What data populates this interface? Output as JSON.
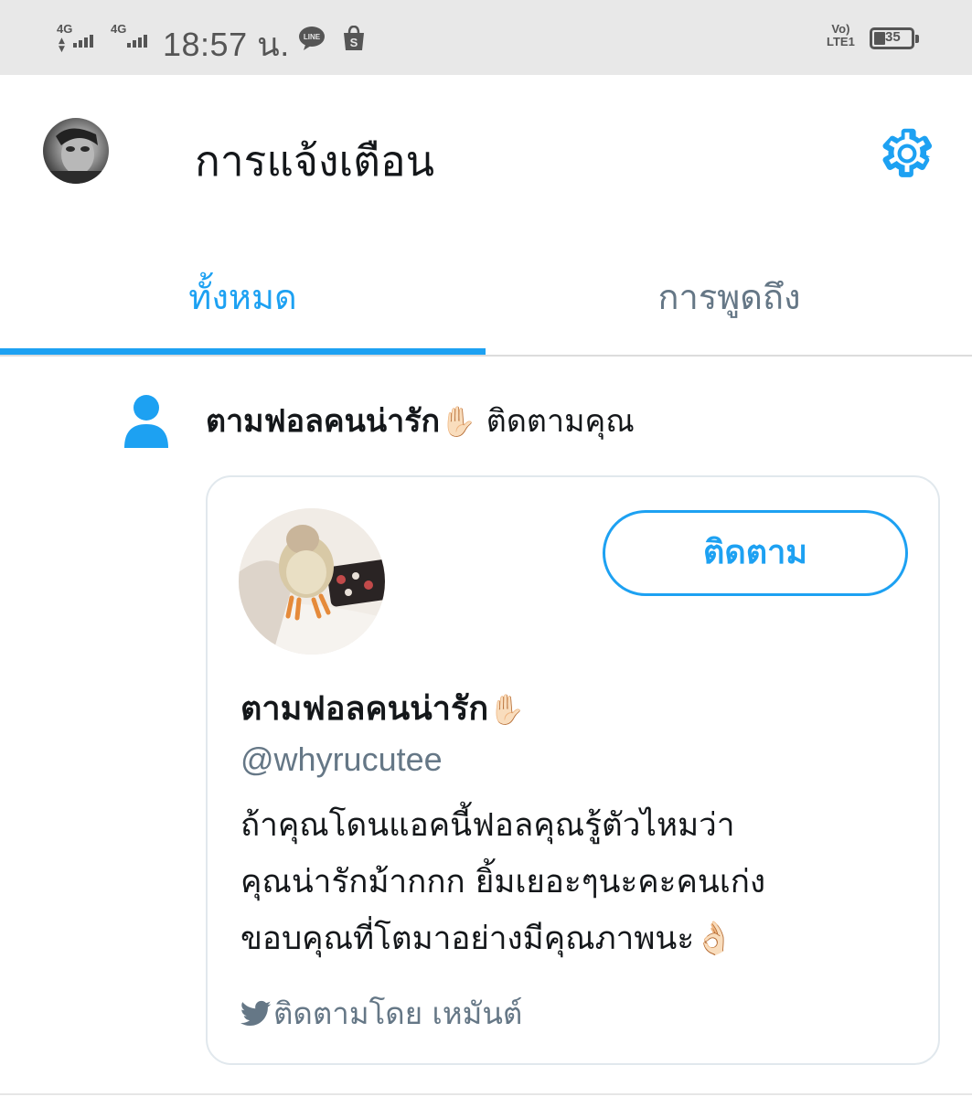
{
  "status_bar": {
    "network_1": "4G",
    "network_2": "4G",
    "time": "18:57 น.",
    "volte_top": "Vo)",
    "volte_bottom": "LTE1",
    "battery_level": "35",
    "icons": [
      "signal-icon",
      "signal-icon",
      "line-app-icon",
      "shopee-app-icon",
      "volte-icon",
      "battery-icon"
    ]
  },
  "header": {
    "title": "การแจ้งเตือน",
    "avatar_icon": "profile-avatar",
    "settings_icon": "gear-icon"
  },
  "tabs": [
    {
      "label": "ทั้งหมด",
      "active": true
    },
    {
      "label": "การพูดถึง",
      "active": false
    }
  ],
  "notification": {
    "icon": "person-icon",
    "actor_name": "ตามฟอลคนน่ารัก",
    "actor_emoji": "✋🏻",
    "action_text": "ติดตามคุณ",
    "card": {
      "follow_button": "ติดตาม",
      "name": "ตามฟอลคนน่ารัก",
      "name_emoji": "✋🏻",
      "handle": "@whyrucutee",
      "bio_lines": [
        "ถ้าคุณโดนแอคนี้ฟอลคุณรู้ตัวไหมว่า",
        "คุณน่ารักม้ากกก ยิ้มเยอะๆนะคะคนเก่ง",
        "ขอบคุณที่โตมาอย่างมีคุณภาพนะ👌🏻"
      ],
      "followed_by": "ติดตามโดย เหมันต์",
      "followed_by_icon": "twitter-bird-icon"
    }
  },
  "colors": {
    "accent": "#1da1f2",
    "text_primary": "#14171a",
    "text_secondary": "#657786",
    "status_bar_bg": "#e8e8e8",
    "border": "#e1e8ed"
  }
}
